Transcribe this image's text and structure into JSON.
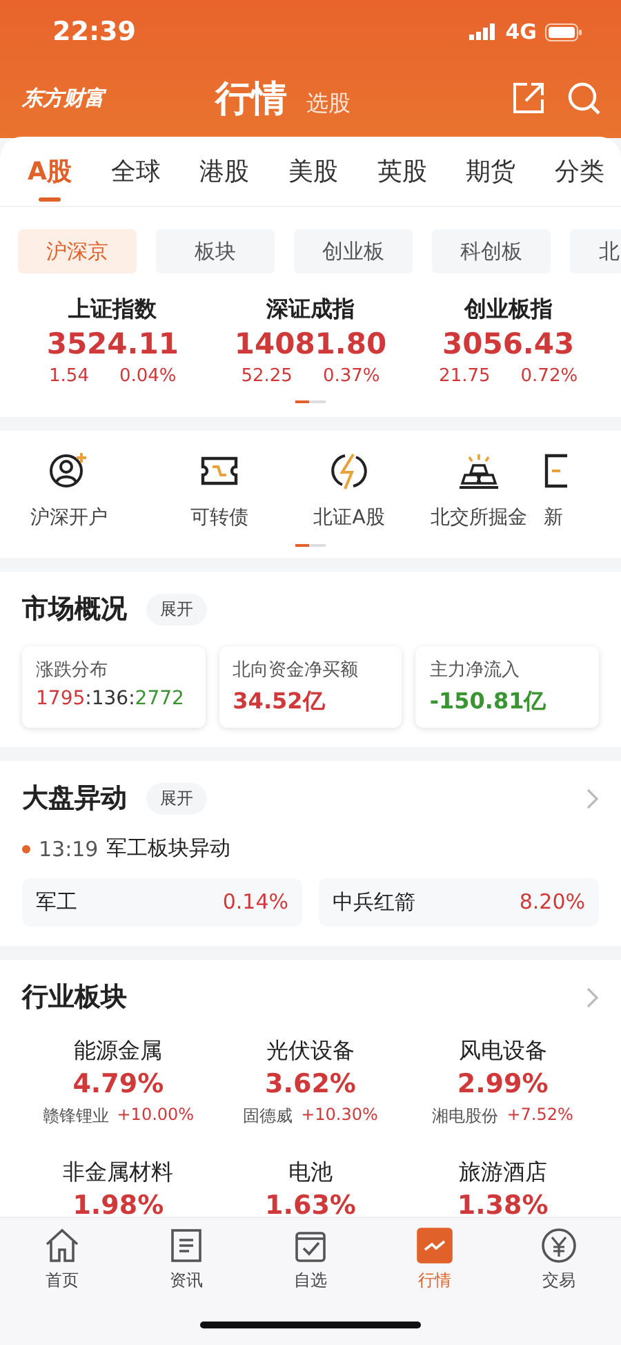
{
  "status": {
    "time": "22:39",
    "network": "4G"
  },
  "header": {
    "logo": "东方财富",
    "title": "行情",
    "subtitle": "选股"
  },
  "tabs": [
    {
      "label": "A股",
      "selected": true
    },
    {
      "label": "全球",
      "selected": false
    },
    {
      "label": "港股",
      "selected": false
    },
    {
      "label": "美股",
      "selected": false
    },
    {
      "label": "英股",
      "selected": false
    },
    {
      "label": "期货",
      "selected": false
    },
    {
      "label": "分类",
      "selected": false
    }
  ],
  "chips": [
    {
      "label": "沪深京",
      "selected": true
    },
    {
      "label": "板块",
      "selected": false
    },
    {
      "label": "创业板",
      "selected": false
    },
    {
      "label": "科创板",
      "selected": false
    },
    {
      "label": "北",
      "selected": false
    }
  ],
  "indices": [
    {
      "name": "上证指数",
      "value": "3524.11",
      "change": "1.54",
      "pct": "0.04%"
    },
    {
      "name": "深证成指",
      "value": "14081.80",
      "change": "52.25",
      "pct": "0.37%"
    },
    {
      "name": "创业板指",
      "value": "3056.43",
      "change": "21.75",
      "pct": "0.72%"
    }
  ],
  "shortcuts": [
    {
      "label": "沪深开户",
      "kind": "person"
    },
    {
      "label": "可转债",
      "kind": "ticket"
    },
    {
      "label": "北证A股",
      "kind": "bolt"
    },
    {
      "label": "北交所掘金",
      "kind": "gold"
    },
    {
      "label": "新",
      "kind": "doc"
    }
  ],
  "overview": {
    "title": "市场概况",
    "expand": "展开",
    "cards": [
      {
        "label": "涨跌分布",
        "parts": [
          {
            "text": "1795",
            "kind": "up"
          },
          {
            "text": ":136:",
            "kind": "flat"
          },
          {
            "text": "2772",
            "kind": "down"
          }
        ]
      },
      {
        "label": "北向资金净买额",
        "parts": [
          {
            "text": "34.52亿",
            "kind": "up"
          }
        ]
      },
      {
        "label": "主力净流入",
        "parts": [
          {
            "text": "-150.81亿",
            "kind": "down"
          }
        ]
      }
    ]
  },
  "movers": {
    "title": "大盘异动",
    "expand": "展开",
    "event": {
      "time": "13:19",
      "text": "军工板块异动"
    },
    "items": [
      {
        "name": "军工",
        "pct": "0.14%"
      },
      {
        "name": "中兵红箭",
        "pct": "8.20%"
      }
    ]
  },
  "sectors": {
    "title": "行业板块",
    "items": [
      {
        "name": "能源金属",
        "pct": "4.79%",
        "leader": "赣锋锂业",
        "leader_pct": "+10.00%"
      },
      {
        "name": "光伏设备",
        "pct": "3.62%",
        "leader": "固德威",
        "leader_pct": "+10.30%"
      },
      {
        "name": "风电设备",
        "pct": "2.99%",
        "leader": "湘电股份",
        "leader_pct": "+7.52%"
      },
      {
        "name": "非金属材料",
        "pct": "1.98%"
      },
      {
        "name": "电池",
        "pct": "1.63%"
      },
      {
        "name": "旅游酒店",
        "pct": "1.38%"
      }
    ]
  },
  "nav": [
    {
      "label": "首页",
      "kind": "home",
      "selected": false
    },
    {
      "label": "资讯",
      "kind": "news",
      "selected": false
    },
    {
      "label": "自选",
      "kind": "check",
      "selected": false
    },
    {
      "label": "行情",
      "kind": "chart",
      "selected": true
    },
    {
      "label": "交易",
      "kind": "yen",
      "selected": false
    }
  ]
}
